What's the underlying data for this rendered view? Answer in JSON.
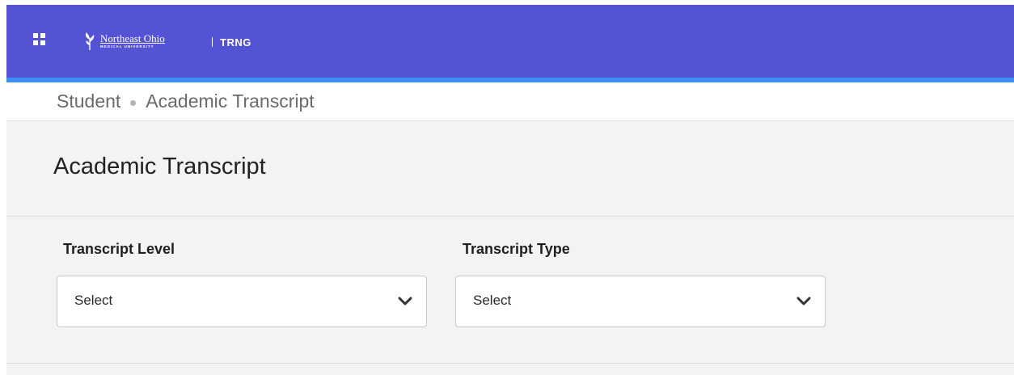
{
  "header": {
    "menu_icon": "grid-menu-icon",
    "logo_name": "Northeast Ohio",
    "logo_sub": "MEDICAL UNIVERSITY",
    "environment": "TRNG",
    "bar_color": "#5353d3",
    "accent_color": "#3f8ef5"
  },
  "breadcrumb": {
    "items": [
      "Student",
      "Academic Transcript"
    ]
  },
  "page": {
    "title": "Academic Transcript"
  },
  "form": {
    "transcript_level": {
      "label": "Transcript Level",
      "value": "Select"
    },
    "transcript_type": {
      "label": "Transcript Type",
      "value": "Select"
    }
  }
}
